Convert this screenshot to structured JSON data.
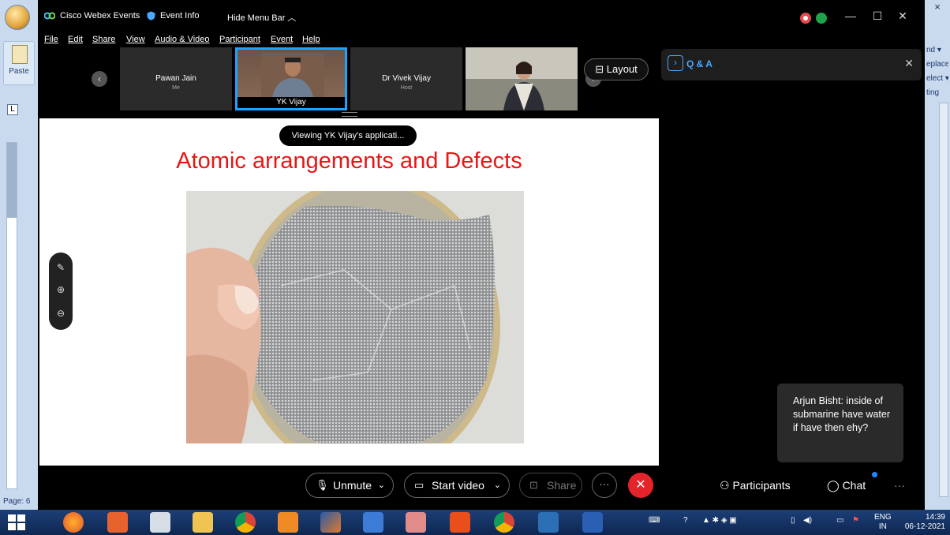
{
  "app": {
    "title": "Cisco Webex Events",
    "event_info": "Event Info",
    "hide_menu": "Hide Menu Bar",
    "menu": [
      "File",
      "Edit",
      "Share",
      "View",
      "Audio & Video",
      "Participant",
      "Event",
      "Help"
    ]
  },
  "background_word": {
    "paste_label": "Paste",
    "page_label": "Page: 6",
    "right_items": [
      "nd ▾",
      "eplace",
      "elect ▾",
      "ting"
    ]
  },
  "participants": [
    {
      "name": "Pawan Jain",
      "role": "Me"
    },
    {
      "name": "YK Vijay",
      "role": ""
    },
    {
      "name": "Dr Vivek Vijay",
      "role": "Host"
    },
    {
      "name": "",
      "role": ""
    }
  ],
  "layout_label": "Layout",
  "qa": {
    "title": "Q & A"
  },
  "sharing_text": "Viewing YK Vijay's applicati...",
  "slide": {
    "title": "Atomic arrangements and Defects"
  },
  "chat_toast": "Arjun Bisht: inside of submarine have water if have then ehy?",
  "controls": {
    "unmute": "Unmute",
    "start_video": "Start video",
    "share": "Share",
    "participants": "Participants",
    "chat": "Chat"
  },
  "taskbar": {
    "lang_line1": "ENG",
    "lang_line2": "IN",
    "time": "14:39",
    "date": "06-12-2021"
  },
  "colors": {
    "accent": "#1aa3ff",
    "slide_title": "#e81515",
    "end_call": "#e5232a",
    "taskbar": "#1c3f77"
  }
}
